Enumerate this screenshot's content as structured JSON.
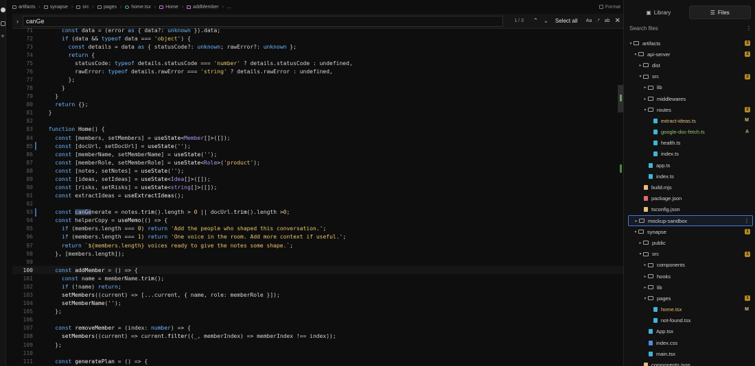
{
  "breadcrumb": {
    "items": [
      "artifacts",
      "synapse",
      "src",
      "pages",
      "home.tsx",
      "Home",
      "addMember",
      "..."
    ],
    "format_label": "Format"
  },
  "find": {
    "query": "canGe",
    "count": "1 / 3",
    "prev_icon": "arrow-up-icon",
    "next_icon": "arrow-down-icon",
    "select_all_label": "Select all",
    "case_label": "Aa",
    "regex_label": ".*",
    "word_label": "ab"
  },
  "code": {
    "lines": [
      {
        "n": "71",
        "html": "      <span class=\"k\">const</span> data = (error <span class=\"k\">as</span> { data?: <span class=\"k\">unknown</span> }).data;"
      },
      {
        "n": "72",
        "html": "      <span class=\"k\">if</span> (data && <span class=\"k\">typeof</span> data === <span class=\"s\">'object'</span>) {"
      },
      {
        "n": "73",
        "html": "        <span class=\"k\">const</span> details = data <span class=\"k\">as</span> { statusCode?: <span class=\"k\">unknown</span>; rawError?: <span class=\"k\">unknown</span> };"
      },
      {
        "n": "74",
        "html": "        <span class=\"k\">return</span> {"
      },
      {
        "n": "75",
        "html": "          statusCode: <span class=\"k\">typeof</span> details.statusCode === <span class=\"s\">'number'</span> ? details.statusCode : undefined,"
      },
      {
        "n": "76",
        "html": "          rawError: <span class=\"k\">typeof</span> details.rawError === <span class=\"s\">'string'</span> ? details.rawError : undefined,"
      },
      {
        "n": "77",
        "html": "        };"
      },
      {
        "n": "78",
        "html": "      }"
      },
      {
        "n": "79",
        "html": "    }"
      },
      {
        "n": "80",
        "html": "    <span class=\"k\">return</span> {};"
      },
      {
        "n": "81",
        "html": "  }"
      },
      {
        "n": "82",
        "html": ""
      },
      {
        "n": "83",
        "html": "  <span class=\"k\">function</span> <span class=\"f\">Home</span>() {"
      },
      {
        "n": "84",
        "html": "    <span class=\"k\">const</span> [members, setMembers] = <span class=\"f\">useState</span><<span class=\"t\">Member</span>[]>([]);"
      },
      {
        "n": "85",
        "mod": true,
        "html": "    <span class=\"k\">const</span> [docUrl, setDocUrl] = <span class=\"f\">useState</span>(<span class=\"s\">''</span>);"
      },
      {
        "n": "86",
        "html": "    <span class=\"k\">const</span> [memberName, setMemberName] = <span class=\"f\">useState</span>(<span class=\"s\">''</span>);"
      },
      {
        "n": "87",
        "html": "    <span class=\"k\">const</span> [memberRole, setMemberRole] = <span class=\"f\">useState</span><<span class=\"t\">Role</span>>(<span class=\"s\">'product'</span>);"
      },
      {
        "n": "88",
        "html": "    <span class=\"k\">const</span> [notes, setNotes] = <span class=\"f\">useState</span>(<span class=\"s\">''</span>);"
      },
      {
        "n": "89",
        "html": "    <span class=\"k\">const</span> [ideas, setIdeas] = <span class=\"f\">useState</span><<span class=\"t\">Idea</span>[]>([]);"
      },
      {
        "n": "90",
        "html": "    <span class=\"k\">const</span> [risks, setRisks] = <span class=\"f\">useState</span><<span class=\"t\">string</span>[]>([]);"
      },
      {
        "n": "91",
        "html": "    <span class=\"k\">const</span> extractIdeas = <span class=\"f\">useExtractIdeas</span>();"
      },
      {
        "n": "92",
        "html": ""
      },
      {
        "n": "93",
        "mod": true,
        "html": "    <span class=\"k\">const</span> <span class=\"hl\">canGe</span>nerate = notes.<span class=\"f\">trim</span>().length > <span class=\"n\">0</span> || docUrl.<span class=\"f\">trim</span>().length ><span class=\"n\">0</span>;"
      },
      {
        "n": "94",
        "html": "    <span class=\"k\">const</span> helperCopy = <span class=\"f\">useMemo</span>(() => {"
      },
      {
        "n": "95",
        "html": "      <span class=\"k\">if</span> (members.length === <span class=\"n\">0</span>) <span class=\"k\">return</span> <span class=\"s\">'Add the people who shaped this conversation.'</span>;"
      },
      {
        "n": "96",
        "html": "      <span class=\"k\">if</span> (members.length === <span class=\"n\">1</span>) <span class=\"k\">return</span> <span class=\"s\">'One voice in the room. Add more context if useful.'</span>;"
      },
      {
        "n": "97",
        "html": "      <span class=\"k\">return</span> <span class=\"s\">`${members.length} voices ready to give the notes some shape.`</span>;"
      },
      {
        "n": "98",
        "html": "    }, [members.length]);"
      },
      {
        "n": "99",
        "html": ""
      },
      {
        "n": "100",
        "cur": true,
        "html": "    <span class=\"k\">const</span> <span class=\"f\">addMember</span> = () => {"
      },
      {
        "n": "101",
        "html": "      <span class=\"k\">const</span> name = memberName.<span class=\"f\">trim</span>();"
      },
      {
        "n": "102",
        "html": "      <span class=\"k\">if</span> (!name) <span class=\"k\">return</span>;"
      },
      {
        "n": "103",
        "html": "      <span class=\"f\">setMembers</span>((current) => [...current, { name, role: memberRole }]);"
      },
      {
        "n": "104",
        "html": "      <span class=\"f\">setMemberName</span>(<span class=\"s\">''</span>);"
      },
      {
        "n": "105",
        "html": "    };"
      },
      {
        "n": "106",
        "html": ""
      },
      {
        "n": "107",
        "html": "    <span class=\"k\">const</span> <span class=\"f\">removeMember</span> = (index: <span class=\"k\">number</span>) => {"
      },
      {
        "n": "108",
        "html": "      <span class=\"f\">setMembers</span>((current) => current.<span class=\"f\">filter</span>((_, memberIndex) => memberIndex !== index));"
      },
      {
        "n": "109",
        "html": "    };"
      },
      {
        "n": "110",
        "html": ""
      },
      {
        "n": "111",
        "html": "    <span class=\"k\">const</span> <span class=\"f\">generatePlan</span> = () => {"
      }
    ]
  },
  "sidebar": {
    "tabs": [
      {
        "label": "Library",
        "icon": "library-icon",
        "active": false
      },
      {
        "label": "Files",
        "icon": "files-icon",
        "active": true
      }
    ],
    "search_placeholder": "Search files",
    "tree": [
      {
        "depth": 0,
        "type": "folder",
        "open": true,
        "label": "artifacts",
        "badge": "3"
      },
      {
        "depth": 1,
        "type": "folder",
        "open": true,
        "label": "api-server",
        "badge": "2"
      },
      {
        "depth": 2,
        "type": "folder",
        "open": false,
        "label": "dist"
      },
      {
        "depth": 2,
        "type": "folder",
        "open": true,
        "label": "src",
        "badge": "2"
      },
      {
        "depth": 3,
        "type": "folder",
        "open": false,
        "label": "lib"
      },
      {
        "depth": 3,
        "type": "folder",
        "open": false,
        "label": "middlewares"
      },
      {
        "depth": 3,
        "type": "folder",
        "open": true,
        "label": "routes",
        "badge": "2"
      },
      {
        "depth": 4,
        "type": "file",
        "label": "extract-ideas.ts",
        "status": "M",
        "git": "m"
      },
      {
        "depth": 4,
        "type": "file",
        "label": "google-doc-fetch.ts",
        "status": "A",
        "git": "a"
      },
      {
        "depth": 4,
        "type": "file",
        "label": "health.ts"
      },
      {
        "depth": 4,
        "type": "file",
        "label": "index.ts"
      },
      {
        "depth": 3,
        "type": "file",
        "label": "app.ts"
      },
      {
        "depth": 3,
        "type": "file",
        "label": "index.ts"
      },
      {
        "depth": 2,
        "type": "file",
        "label": "build.mjs"
      },
      {
        "depth": 2,
        "type": "file",
        "label": "package.json"
      },
      {
        "depth": 2,
        "type": "file",
        "label": "tsconfig.json"
      },
      {
        "depth": 1,
        "type": "folder",
        "open": false,
        "label": "mockup-sandbox",
        "selected": true
      },
      {
        "depth": 1,
        "type": "folder",
        "open": true,
        "label": "synapse",
        "badge": "1"
      },
      {
        "depth": 2,
        "type": "folder",
        "open": false,
        "label": "public"
      },
      {
        "depth": 2,
        "type": "folder",
        "open": true,
        "label": "src",
        "badge": "1"
      },
      {
        "depth": 3,
        "type": "folder",
        "open": false,
        "label": "components"
      },
      {
        "depth": 3,
        "type": "folder",
        "open": false,
        "label": "hooks"
      },
      {
        "depth": 3,
        "type": "folder",
        "open": false,
        "label": "lib"
      },
      {
        "depth": 3,
        "type": "folder",
        "open": true,
        "label": "pages",
        "badge": "1"
      },
      {
        "depth": 4,
        "type": "file",
        "label": "home.tsx",
        "status": "M",
        "git": "m"
      },
      {
        "depth": 4,
        "type": "file",
        "label": "not-found.tsx"
      },
      {
        "depth": 3,
        "type": "file",
        "label": "App.tsx"
      },
      {
        "depth": 3,
        "type": "file",
        "label": "index.css"
      },
      {
        "depth": 3,
        "type": "file",
        "label": "main.tsx"
      },
      {
        "depth": 2,
        "type": "file",
        "label": "components.json"
      }
    ]
  },
  "colors": {
    "background": "#0e0e0e",
    "sidebar": "#121212",
    "keyword": "#6cb6ff",
    "string": "#e9c46a",
    "type": "#b392f0",
    "badge": "#b58a1f",
    "modified": "#e5c07b",
    "added": "#98c379",
    "selection": "#3f7ad6"
  }
}
